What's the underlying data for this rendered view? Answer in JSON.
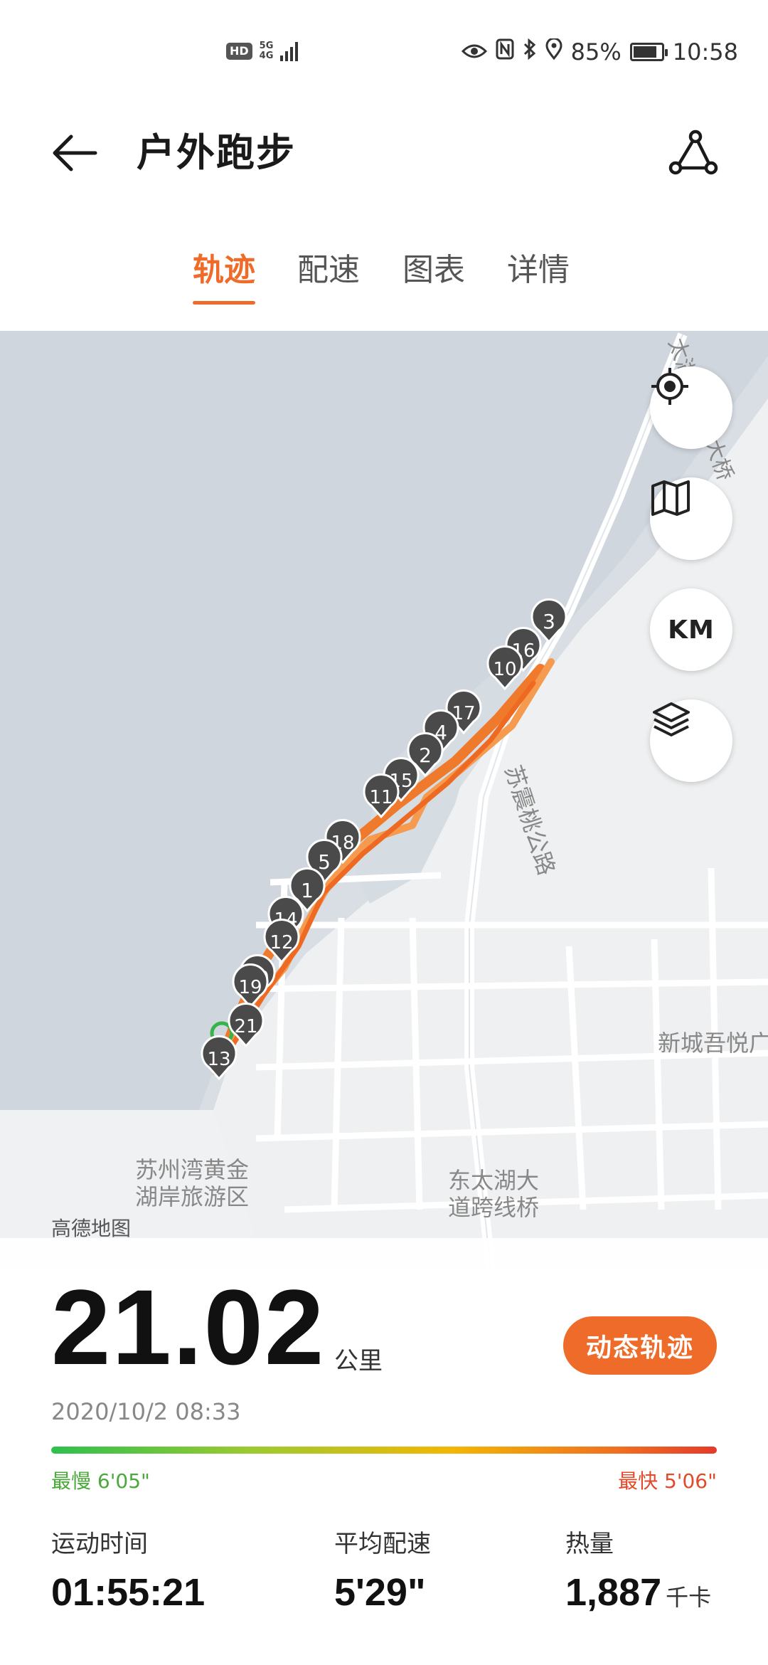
{
  "status_bar": {
    "hd": "HD",
    "network": "5G",
    "network_sub": "4G",
    "battery_percent": "85%",
    "battery_level": 0.85,
    "time": "10:58",
    "icons": [
      "eye-icon",
      "nfc-icon",
      "bluetooth-icon",
      "location-icon",
      "battery-icon"
    ]
  },
  "header": {
    "title": "户外跑步",
    "back_icon": "arrow-left-icon",
    "share_icon": "share-icon"
  },
  "tabs": [
    {
      "label": "轨迹",
      "active": true
    },
    {
      "label": "配速",
      "active": false
    },
    {
      "label": "图表",
      "active": false
    },
    {
      "label": "详情",
      "active": false
    }
  ],
  "map": {
    "labels": {
      "bridge": "太湖苏州湾大桥",
      "road": "苏震桃公路",
      "scenic": "苏州湾黄金\n湖岸旅游区",
      "scenic_line1": "苏州湾黄金",
      "scenic_line2": "湖岸旅游区",
      "overpass_line1": "东太湖大",
      "overpass_line2": "道跨线桥",
      "district": "新城吾悦广"
    },
    "controls": [
      "locate-icon",
      "map-icon",
      "KM",
      "layers-icon"
    ],
    "km_label": "KM",
    "credit": "高德地图",
    "km_markers": [
      "3",
      "16",
      "10",
      "17",
      "4",
      "2",
      "15",
      "11",
      "18",
      "5",
      "1",
      "14",
      "12",
      "20",
      "19",
      "21",
      "13"
    ],
    "colors": {
      "route": "#f07a2c",
      "marker": "#4a4a4a",
      "water": "#d7dde3",
      "land": "#eef0f1",
      "start": "#36b34a"
    }
  },
  "summary": {
    "distance": "21.02",
    "distance_unit": "公里",
    "replay_button": "动态轨迹",
    "datetime": "2020/10/2 08:33",
    "slowest": "最慢 6'05\"",
    "fastest": "最快 5'06\"",
    "stats": [
      {
        "label": "运动时间",
        "value": "01:55:21",
        "unit": ""
      },
      {
        "label": "平均配速",
        "value": "5'29\"",
        "unit": ""
      },
      {
        "label": "热量",
        "value": "1,887",
        "unit": "千卡"
      }
    ]
  },
  "accent_color": "#ef6b2a"
}
